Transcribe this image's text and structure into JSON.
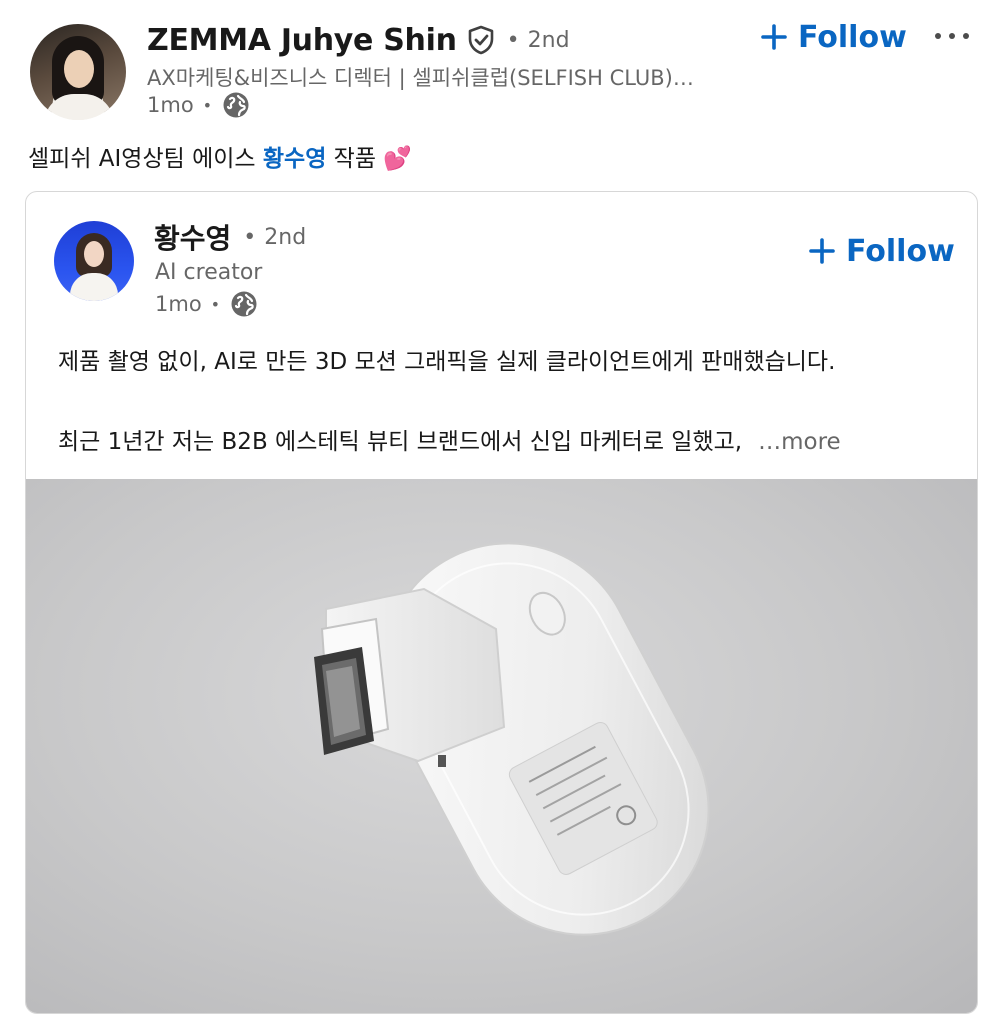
{
  "post": {
    "author": {
      "name": "ZEMMA Juhye Shin",
      "degree": "2nd",
      "headline": "AX마케팅&비즈니스 디렉터 | 셀피쉬클럽(SELFISH CLUB)…",
      "time": "1mo",
      "follow_label": "Follow"
    },
    "text_before": "셀피쉬 AI영상팀 에이스 ",
    "mention": "황수영",
    "text_after": " 작품 💕"
  },
  "shared": {
    "author": {
      "name": "황수영",
      "degree": "2nd",
      "headline": "AI creator",
      "time": "1mo",
      "follow_label": "Follow"
    },
    "line1": "제품 촬영 없이, AI로 만든 3D 모션 그래픽을 실제 클라이언트에게 판매했습니다.",
    "line2": "최근 1년간 저는 B2B 에스테틱 뷰티 브랜드에서 신입 마케터로 일했고,",
    "see_more": "…more"
  },
  "dot": "•",
  "colors": {
    "link_blue": "#0a66c2",
    "secondary_text": "rgba(0,0,0,0.6)"
  },
  "icons": [
    "verified-shield-icon",
    "globe-icon",
    "plus-icon",
    "more-horizontal-icon"
  ]
}
